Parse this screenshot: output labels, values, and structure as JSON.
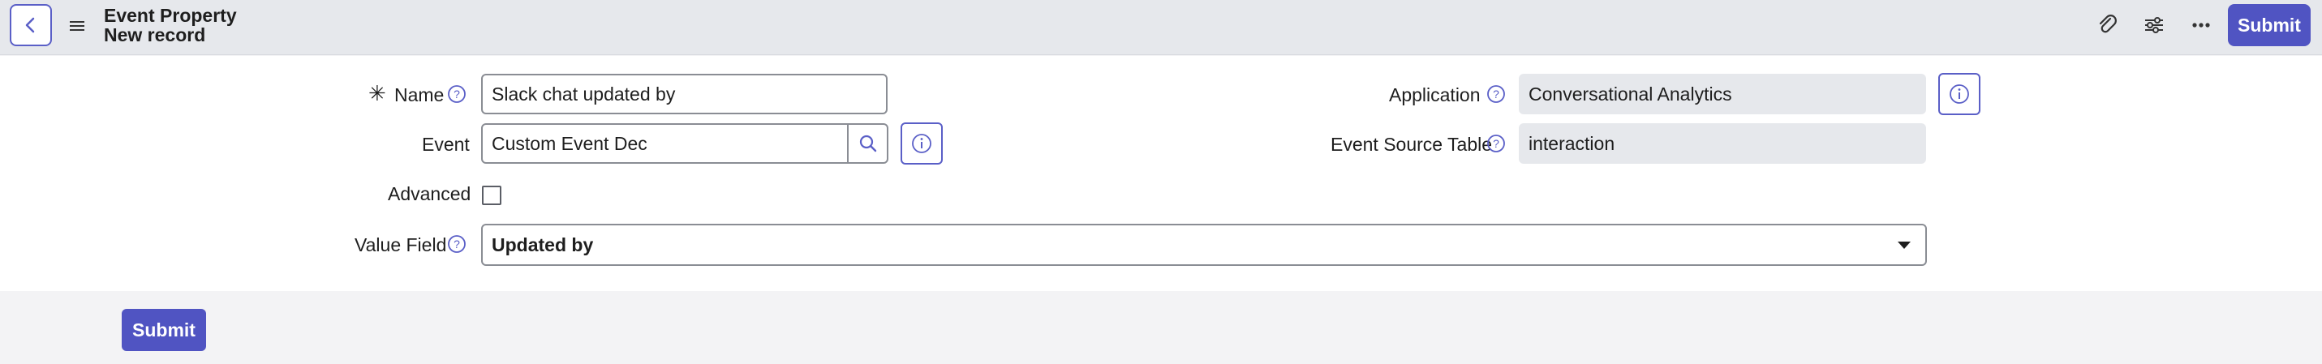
{
  "header": {
    "title_line1": "Event Property",
    "title_line2": "New record",
    "submit_label": "Submit",
    "icons": [
      "back-arrow-icon",
      "hamburger-menu-icon",
      "paperclip-icon",
      "sliders-icon",
      "more-horizontal-icon"
    ]
  },
  "form": {
    "name": {
      "label": "Name",
      "value": "Slack chat updated by",
      "required": true
    },
    "event": {
      "label": "Event",
      "value": "Custom Event Dec"
    },
    "advanced": {
      "label": "Advanced",
      "checked": false
    },
    "value_field": {
      "label": "Value Field",
      "value": "Updated by"
    },
    "application": {
      "label": "Application",
      "value": "Conversational Analytics"
    },
    "event_source_table": {
      "label": "Event Source Table",
      "value": "interaction"
    }
  },
  "footer": {
    "submit_label": "Submit"
  },
  "colors": {
    "accent": "#5054c2",
    "header_bg": "#e6e8ec",
    "readonly_bg": "#e6e8ec",
    "page_bg": "#f3f3f5"
  }
}
